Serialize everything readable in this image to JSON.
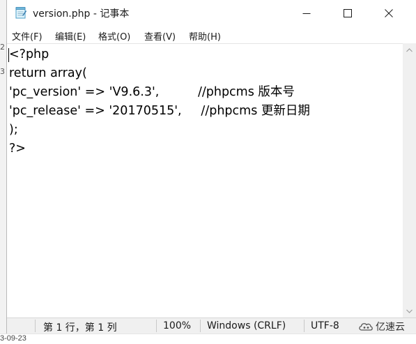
{
  "background": {
    "side_digits": [
      "2",
      "3"
    ],
    "bottom_date": "3-09-23"
  },
  "window": {
    "title": "version.php - 记事本"
  },
  "menu": [
    {
      "label": "文件(F)"
    },
    {
      "label": "编辑(E)"
    },
    {
      "label": "格式(O)"
    },
    {
      "label": "查看(V)"
    },
    {
      "label": "帮助(H)"
    }
  ],
  "editor": {
    "lines": [
      "<?php",
      "return array(",
      "'pc_version' => 'V9.6.3',          //phpcms 版本号",
      "'pc_release' => '20170515',     //phpcms 更新日期",
      ");",
      "?>"
    ]
  },
  "status": {
    "position": "第 1 行，第 1 列",
    "zoom": "100%",
    "line_ending": "Windows (CRLF)",
    "encoding": "UTF-8"
  },
  "watermark": {
    "text": "亿速云"
  },
  "colors": {
    "text": "#000000",
    "chrome": "#f0f0f0",
    "border": "#b9b9b9"
  }
}
